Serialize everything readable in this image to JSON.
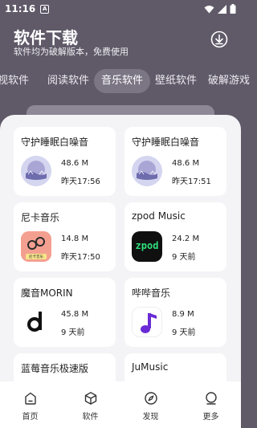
{
  "status_bar": {
    "time": "11:16",
    "notif_letter": "A"
  },
  "header": {
    "title": "软件下载",
    "subtitle": "软件均为破解版本，免费使用"
  },
  "tabs": [
    {
      "label": "影视软件"
    },
    {
      "label": "阅读软件"
    },
    {
      "label": "音乐软件"
    },
    {
      "label": "壁纸软件"
    },
    {
      "label": "破解游戏"
    }
  ],
  "cards": [
    {
      "title": "守护睡眠白噪音",
      "size": "48.6 M",
      "time": "昨天17:56",
      "icon": "sleep-noise-icon"
    },
    {
      "title": "守护睡眠白噪音",
      "size": "48.6 M",
      "time": "昨天17:51",
      "icon": "sleep-noise-icon"
    },
    {
      "title": "尼卡音乐",
      "size": "14.8 M",
      "time": "昨天17:50",
      "icon": "nika-music-icon",
      "icon_text": "尼卡音乐"
    },
    {
      "title": "zpod Music",
      "size": "24.2 M",
      "time": "9 天前",
      "icon": "zpod-icon",
      "icon_text": "zpod"
    },
    {
      "title": "魔音MORIN",
      "size": "45.8 M",
      "time": "9 天前",
      "icon": "morin-icon"
    },
    {
      "title": "哔哔音乐",
      "size": "8.9 M",
      "time": "9 天前",
      "icon": "music-note-icon"
    },
    {
      "title": "蓝莓音乐极速版",
      "size": "",
      "time": "",
      "icon": ""
    },
    {
      "title": "JuMusic",
      "size": "",
      "time": "",
      "icon": ""
    }
  ],
  "bottom_nav": [
    {
      "label": "首页",
      "icon": "home-icon"
    },
    {
      "label": "软件",
      "icon": "box-icon"
    },
    {
      "label": "发现",
      "icon": "compass-icon"
    },
    {
      "label": "更多",
      "icon": "more-icon"
    }
  ],
  "colors": {
    "header_bg": "#5f5968",
    "panel_bg": "#f4f3f6",
    "active_tab_bg": "#7b7584"
  }
}
